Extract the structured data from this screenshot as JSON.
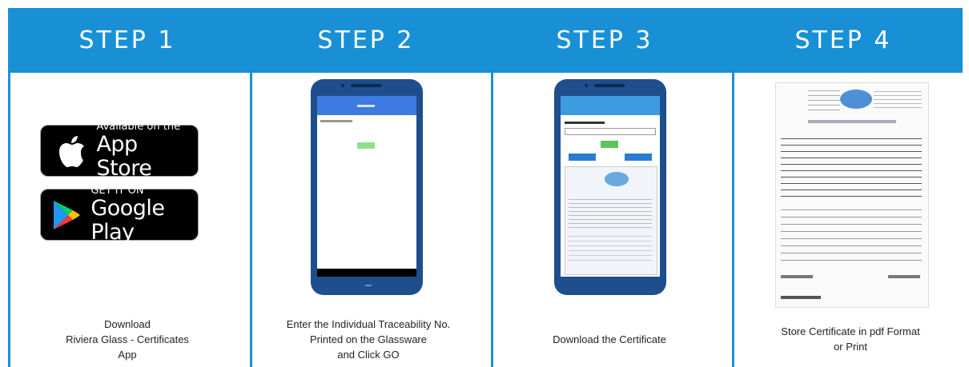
{
  "steps": [
    {
      "title": "STEP 1",
      "caption_lines": [
        "Download",
        "Riviera Glass - Certificates",
        "App"
      ]
    },
    {
      "title": "STEP 2",
      "caption_lines": [
        "Enter the Individual Traceability No.",
        "Printed on the Glassware",
        "and Click GO"
      ]
    },
    {
      "title": "STEP 3",
      "caption_lines": [
        "Download the Certificate"
      ]
    },
    {
      "title": "STEP 4",
      "caption_lines": [
        "Store  Certificate in pdf Format",
        "or Print"
      ]
    }
  ],
  "badges": {
    "appstore": {
      "small": "Available on the",
      "big": "App Store",
      "icon": "apple-icon"
    },
    "googleplay": {
      "small": "GET IT ON",
      "big": "Google Play",
      "icon": "google-play-icon"
    }
  },
  "colors": {
    "accent": "#1990d6",
    "phone": "#1e4f8c",
    "badge_bg": "#000000"
  }
}
